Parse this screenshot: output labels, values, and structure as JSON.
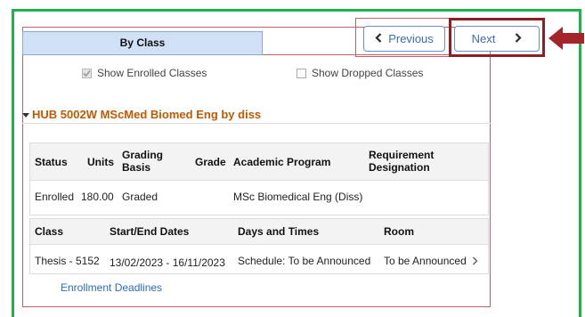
{
  "tab": {
    "label": "By Class"
  },
  "nav": {
    "previous_label": "Previous",
    "next_label": "Next"
  },
  "filters": {
    "show_enrolled": {
      "label": "Show Enrolled Classes",
      "checked": true
    },
    "show_dropped": {
      "label": "Show Dropped Classes",
      "checked": false
    }
  },
  "course": {
    "title": "HUB 5002W MScMed Biomed Eng by diss"
  },
  "summary_table": {
    "headers": {
      "status": "Status",
      "units": "Units",
      "grading_1": "Grading",
      "grading_2": "Basis",
      "grade": "Grade",
      "program": "Academic Program",
      "req_1": "Requirement",
      "req_2": "Designation"
    },
    "row": {
      "status": "Enrolled",
      "units": "180.00",
      "grading": "Graded",
      "grade": "",
      "program": "MSc Biomedical Eng (Diss)",
      "requirement": ""
    }
  },
  "class_table": {
    "headers": {
      "class": "Class",
      "dates": "Start/End Dates",
      "days": "Days and Times",
      "room": "Room"
    },
    "row": {
      "class": "Thesis - 5152",
      "dates": "13/02/2023 - 16/11/2023",
      "days": "Schedule: To be Announced",
      "room": "To be Announced"
    }
  },
  "links": {
    "enrollment_deadlines": "Enrollment Deadlines"
  },
  "colors": {
    "frame_green": "#20b24a",
    "title_orange": "#c15a00",
    "link_blue": "#2b6cc4",
    "annotation_red": "#8c1f23"
  }
}
